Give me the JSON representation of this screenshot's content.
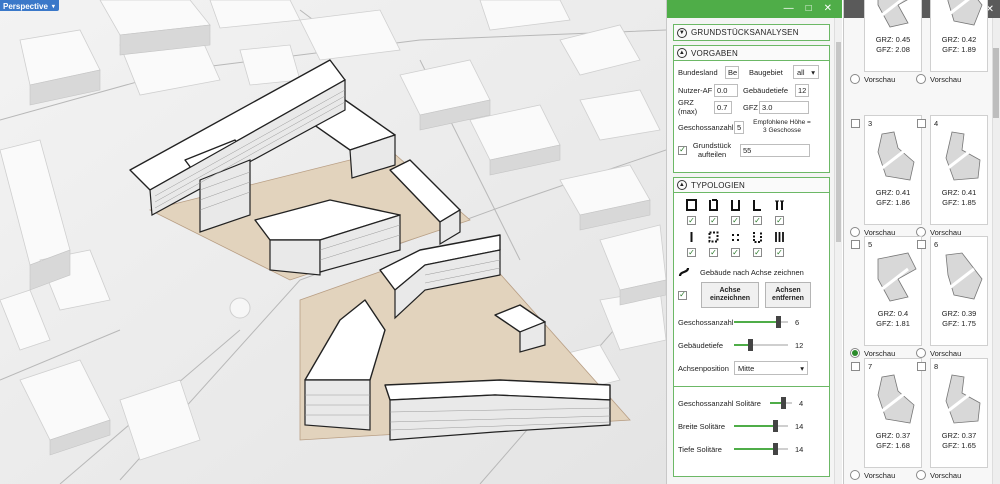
{
  "viewport": {
    "label": "Perspective",
    "dropdown_glyph": "▾"
  },
  "panel": {
    "window_buttons": [
      "—",
      "□",
      "✕"
    ],
    "sections": {
      "analysen": {
        "title": "GRUNDSTÜCKSANALYSEN"
      },
      "vorgaben": {
        "title": "VORGABEN",
        "bundesland_label": "Bundesland",
        "bundesland_value": "Be",
        "baugebiet_label": "Baugebiet",
        "baugebiet_value": "all",
        "nutzer_label": "Nutzer-AF",
        "nutzer_value": "0.0",
        "gebaeudetiefe_label": "Gebäudetiefe",
        "gebaeudetiefe_value": "12",
        "grz_label": "GRZ (max)",
        "grz_value": "0.7",
        "gfz_label": "GFZ",
        "gfz_value": "3.0",
        "geschossanzahl_label": "Geschossanzahl",
        "geschossanzahl_value": "5",
        "empfohlen_text": "Empfohlene Höhe = 3 Geschosse",
        "aufteilen_label": "Grundstück aufteilen",
        "aufteilen_value": "55"
      },
      "typologien": {
        "title": "TYPOLOGIEN",
        "row1": [
          "square",
          "u-open",
          "u",
          "l",
          "bars"
        ],
        "row2": [
          "i-bar",
          "dotted-square",
          "dots",
          "dotted-u",
          "pillars"
        ],
        "achse_label": "Gebäude nach Achse zeichnen",
        "btn_einzeichnen": "Achse einzeichnen",
        "btn_entfernen": "Achsen entfernen",
        "geschossanzahl_label": "Geschossanzahl",
        "geschossanzahl_value": "6",
        "gebaeudetiefe_label": "Gebäudetiefe",
        "gebaeudetiefe_value": "12",
        "achsenposition_label": "Achsenposition",
        "achsenposition_value": "Mitte",
        "solitaere_label": "Geschossanzahl Solitäre",
        "solitaere_value": "4",
        "breite_label": "Breite Solitäre",
        "breite_value": "14",
        "tiefe_label": "Tiefe Solitäre",
        "tiefe_value": "14"
      }
    }
  },
  "variants": {
    "window_buttons": [
      "—",
      "✕"
    ],
    "vorschau_label": "Vorschau",
    "cards": [
      {
        "num": "",
        "grz": "GRZ: 0.45",
        "gfz": "GFZ: 2.08",
        "selected": false
      },
      {
        "num": "",
        "grz": "GRZ: 0.42",
        "gfz": "GFZ: 1.89",
        "selected": false
      },
      {
        "num": "3",
        "grz": "GRZ: 0.41",
        "gfz": "GFZ: 1.86",
        "selected": false
      },
      {
        "num": "4",
        "grz": "GRZ: 0.41",
        "gfz": "GFZ: 1.85",
        "selected": false
      },
      {
        "num": "5",
        "grz": "GRZ: 0.4",
        "gfz": "GFZ: 1.81",
        "selected": true
      },
      {
        "num": "6",
        "grz": "GRZ: 0.39",
        "gfz": "GFZ: 1.75",
        "selected": false
      },
      {
        "num": "7",
        "grz": "GRZ: 0.37",
        "gfz": "GFZ: 1.68",
        "selected": false
      },
      {
        "num": "8",
        "grz": "GRZ: 0.37",
        "gfz": "GFZ: 1.65",
        "selected": false
      }
    ]
  }
}
